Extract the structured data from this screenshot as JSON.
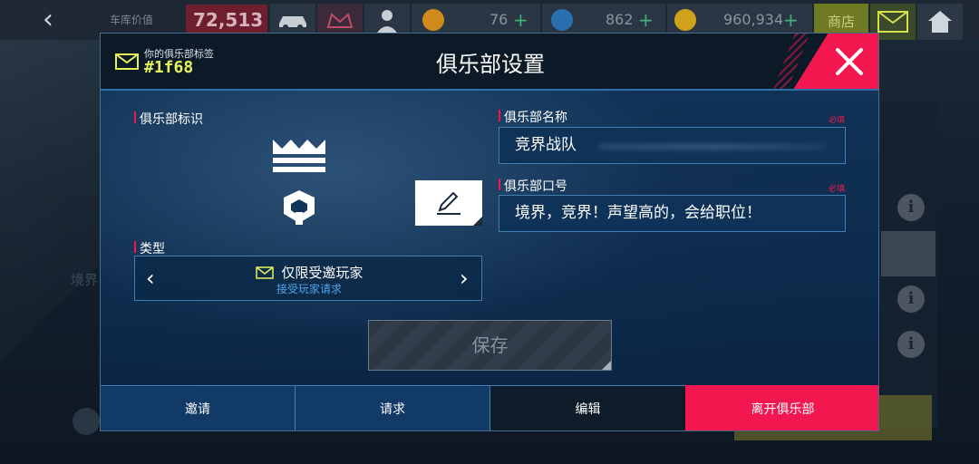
{
  "topbar": {
    "garage_value_label": "车库价值",
    "garage_value": "72,513",
    "currency_tokens": "76",
    "currency_blueprints": "862",
    "currency_credits": "960,934",
    "plus": "+",
    "shop_label": "商店"
  },
  "background": {
    "left_text": "境界"
  },
  "modal": {
    "club_tag_label": "你的俱乐部标签",
    "club_tag_value": "#1f68",
    "title": "俱乐部设置",
    "emblem_label": "俱乐部标识",
    "type_label": "类型",
    "type_value": "仅限受邀玩家",
    "type_subtext": "接受玩家请求",
    "club_name_label": "俱乐部名称",
    "club_name_value": "竞界战队",
    "club_motto_label": "俱乐部口号",
    "club_motto_value": "境界，竞界！声望高的，会给职位！",
    "required_label": "必填",
    "save_label": "保存",
    "tabs": [
      "邀请",
      "请求",
      "编辑",
      "离开俱乐部"
    ]
  },
  "colors": {
    "accent_red": "#f2184f",
    "tag_yellow": "#e8f35a",
    "field_border": "#3f7db3",
    "subtext_blue": "#4ea3e6"
  },
  "icons": [
    "back-arrow-icon",
    "car-icon",
    "club-icon",
    "avatar-icon",
    "token-icon",
    "blueprint-icon",
    "credits-icon",
    "mail-icon",
    "home-icon",
    "envelope-icon",
    "close-icon",
    "crown-emblem-icon",
    "pencil-icon",
    "chevron-left-icon",
    "chevron-right-icon",
    "info-icon"
  ]
}
